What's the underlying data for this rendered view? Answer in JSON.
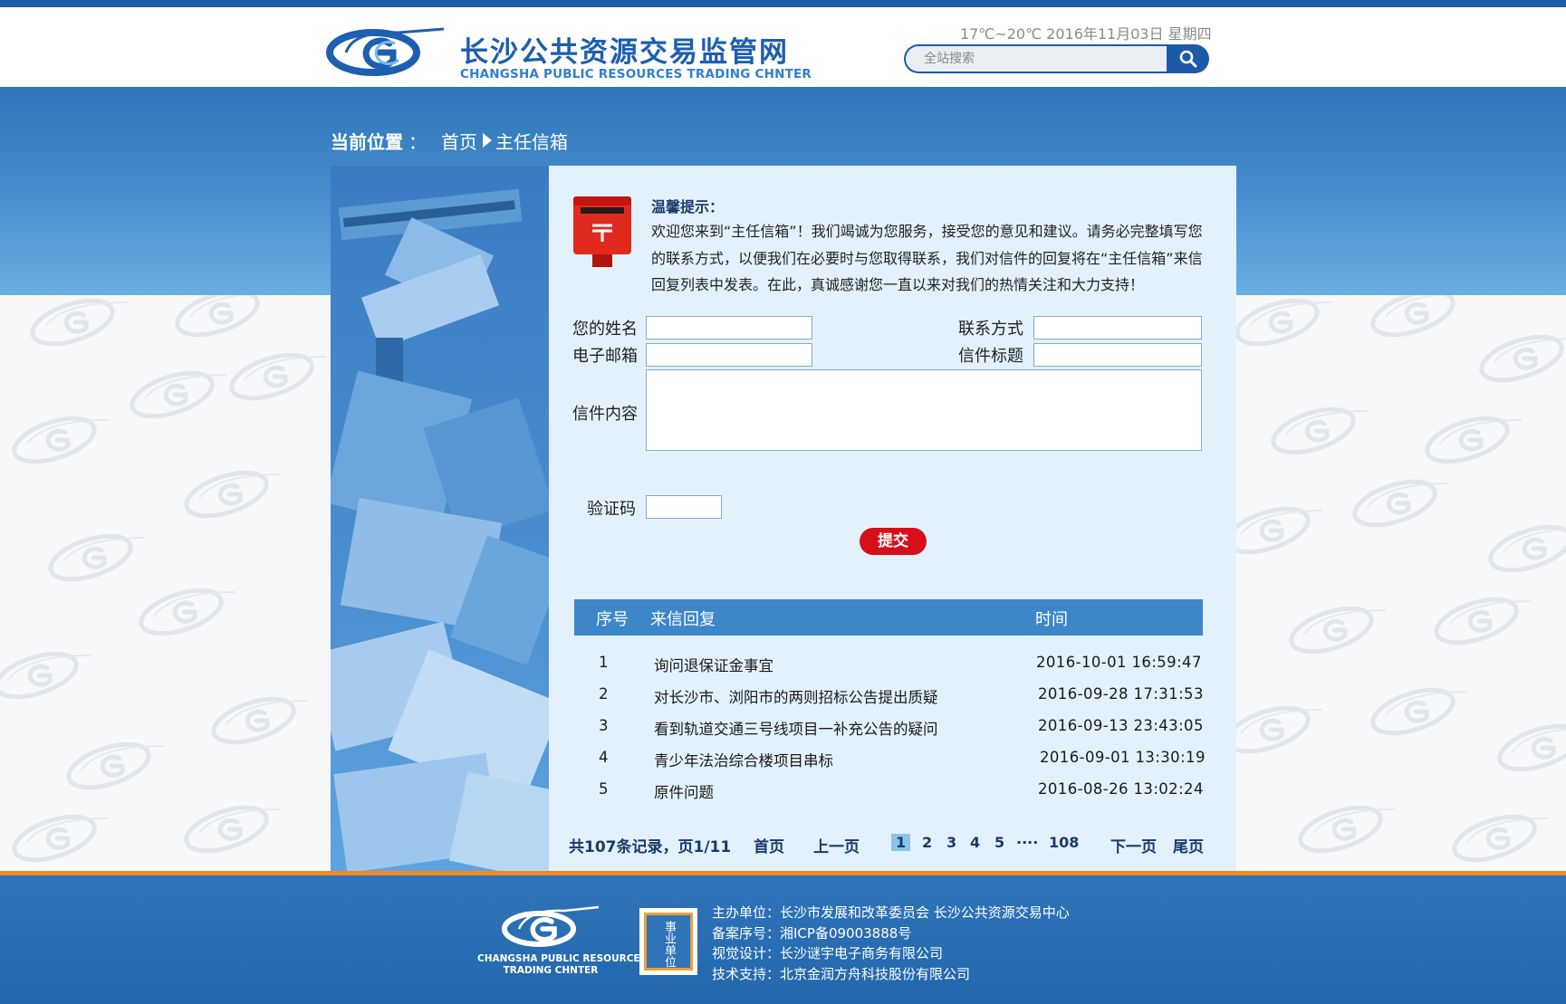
{
  "header": {
    "logo_cn": "长沙公共资源交易监管网",
    "logo_en": "CHANGSHA PUBLIC RESOURCES TRADING CHNTER",
    "weather": "17℃~20℃ 2016年11月03日 星期四",
    "search_placeholder": "全站搜索"
  },
  "breadcrumb": {
    "label": "当前位置",
    "sep": "：",
    "home": "首页",
    "current": "主任信箱"
  },
  "notice": {
    "title": "温馨提示：",
    "text": "欢迎您来到“主任信箱”！我们竭诚为您服务，接受您的意见和建议。请务必完整填写您的联系方式，以便我们在必要时与您取得联系，我们对信件的回复将在“主任信箱”来信回复列表中发表。在此，真诚感谢您一直以来对我们的热情关注和大力支持！"
  },
  "form": {
    "name_label": "您的姓名",
    "contact_label": "联系方式",
    "email_label": "电子邮箱",
    "subject_label": "信件标题",
    "content_label": "信件内容",
    "captcha_label": "验证码",
    "submit_label": "提交"
  },
  "table": {
    "headers": {
      "no": "序号",
      "title": "来信回复",
      "time": "时间"
    },
    "rows": [
      {
        "no": "1",
        "title": "询问退保证金事宜",
        "time": "2016-10-01 16:59:47"
      },
      {
        "no": "2",
        "title": "对长沙市、浏阳市的两则招标公告提出质疑",
        "time": "2016-09-28 17:31:53"
      },
      {
        "no": "3",
        "title": "看到轨道交通三号线项目一补充公告的疑问",
        "time": "2016-09-13 23:43:05"
      },
      {
        "no": "4",
        "title": "青少年法治综合楼项目串标",
        "time": "2016-09-01 13:30:19"
      },
      {
        "no": "5",
        "title": "原件问题",
        "time": "2016-08-26 13:02:24"
      }
    ]
  },
  "pager": {
    "summary": "共107条记录，页1/11",
    "first": "首页",
    "prev": "上一页",
    "pages": [
      "1",
      "2",
      "3",
      "4",
      "5"
    ],
    "ellipsis": "····",
    "last_page": "108",
    "next": "下一页",
    "last": "尾页",
    "current_page": 1
  },
  "footer": {
    "logo_en_line1": "CHANGSHA PUBLIC RESOURCES",
    "logo_en_line2": "TRADING CHNTER",
    "badge": "事业单位",
    "host": "主办单位：长沙市发展和改革委员会 长沙公共资源交易中心",
    "icp": "备案序号：湘ICP备09003888号",
    "design": "视觉设计：长沙谜宇电子商务有限公司",
    "tech": "技术支持：北京金润方舟科技股份有限公司"
  },
  "colors": {
    "brand_blue": "#1e5aa8",
    "band_blue": "#2b74b7",
    "panel_bg": "#e3f1fd",
    "table_head": "#3d86c8",
    "submit_red": "#d6101b",
    "footer_orange": "#ef8a23"
  },
  "icons": [
    "search-icon",
    "mailbox-icon",
    "logo-g-icon",
    "breadcrumb-arrow-icon"
  ]
}
